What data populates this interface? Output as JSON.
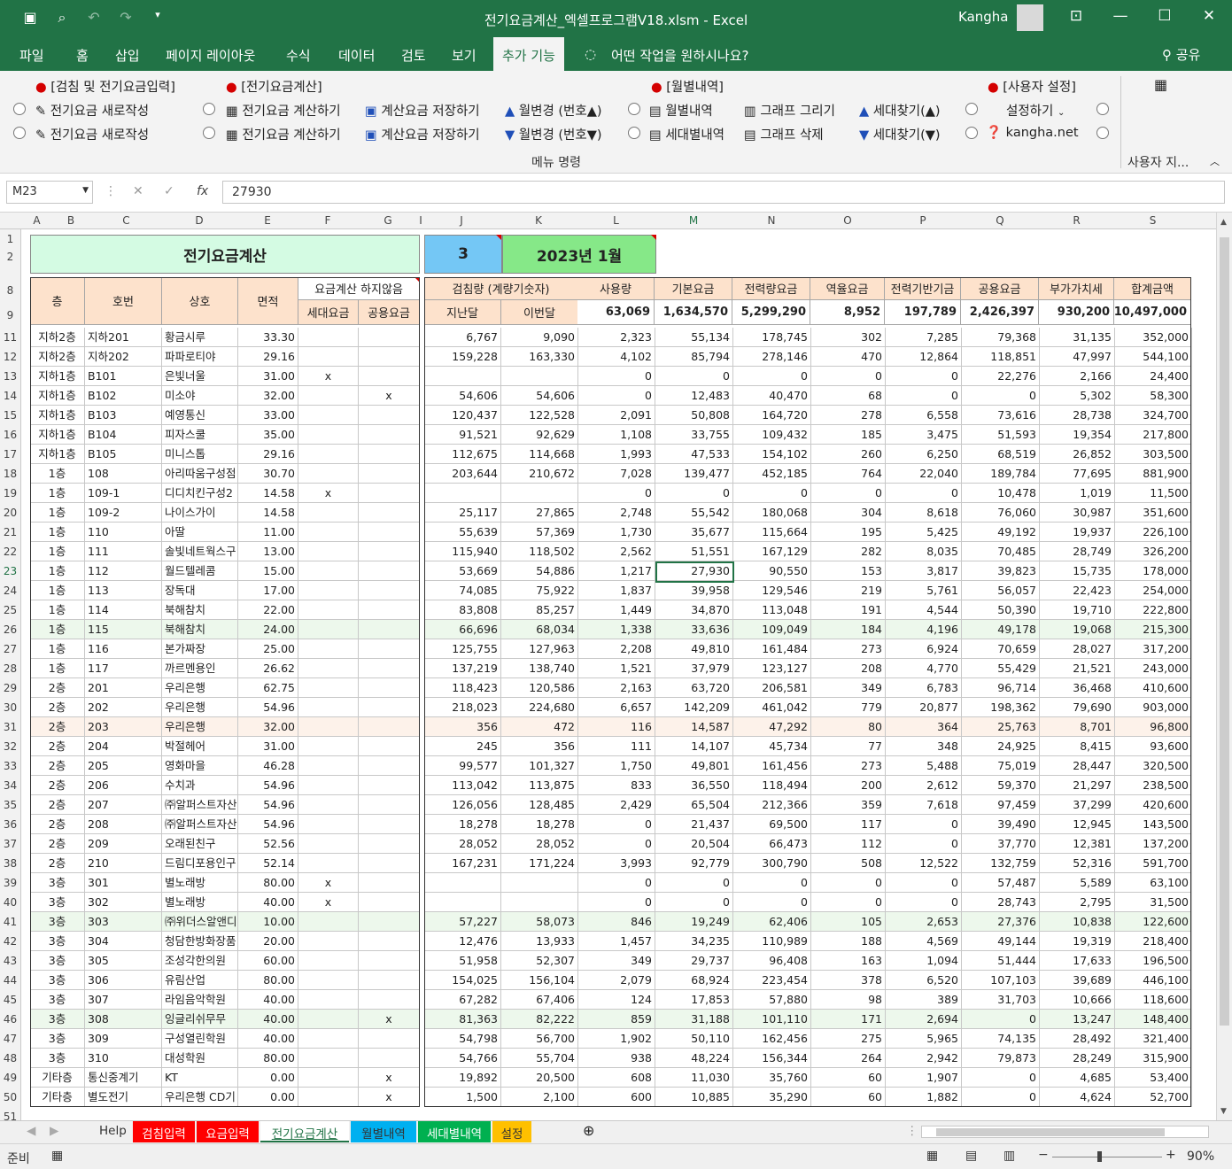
{
  "window": {
    "title": "전기요금계산_엑셀프로그램V18.xlsm  -  Excel",
    "user": "Kangha",
    "qa_icons": [
      "save-icon",
      "print-preview-icon",
      "undo-icon",
      "redo-icon",
      "customize-icon"
    ]
  },
  "menu": {
    "tabs": [
      "파일",
      "홈",
      "삽입",
      "페이지 레이아웃",
      "수식",
      "데이터",
      "검토",
      "보기",
      "추가 기능"
    ],
    "active": "추가 기능",
    "tell_me": "어떤 작업을 원하시나요?",
    "share": "공유"
  },
  "ribbon": {
    "h1": "[검침 및 전기요금입력]",
    "h2": "[전기요금계산]",
    "h3": "[월별내역]",
    "h4": "[사용자 설정]",
    "new1": "전기요금 새로작성",
    "new2": "전기요금 새로작성",
    "calc1": "전기요금 계산하기",
    "calc2": "전기요금 계산하기",
    "save1": "계산요금 저장하기",
    "save2": "계산요금 저장하기",
    "month_up": "월변경 (번호▲)",
    "month_down": "월변경 (번호▼)",
    "monthly": "월별내역",
    "household": "세대별내역",
    "graph_draw": "그래프 그리기",
    "graph_delete": "그래프 삭제",
    "find_up": "세대찾기(▲)",
    "find_down": "세대찾기(▼)",
    "settings": "설정하기",
    "site": "kangha.net",
    "group_label": "메뉴 명령",
    "group_label2": "사용자 지..."
  },
  "formula": {
    "namebox": "M23",
    "value": "27930"
  },
  "columns": [
    "A",
    "B",
    "C",
    "D",
    "E",
    "F",
    "G",
    "I",
    "J",
    "K",
    "L",
    "M",
    "N",
    "O",
    "P",
    "Q",
    "R",
    "S"
  ],
  "rownums": [
    "1",
    "2",
    "8",
    "9",
    "11",
    "12",
    "13",
    "14",
    "15",
    "16",
    "17",
    "18",
    "19",
    "20",
    "21",
    "22",
    "23",
    "24",
    "25",
    "26",
    "27",
    "28",
    "29",
    "30",
    "31",
    "32",
    "33",
    "34",
    "35",
    "36",
    "37",
    "38",
    "39",
    "40",
    "41",
    "42",
    "43",
    "44",
    "45",
    "46",
    "47",
    "48",
    "49",
    "50",
    "51"
  ],
  "sheet": {
    "title": "전기요금계산",
    "month_no": "3",
    "month_label": "2023년 1월",
    "hdr": {
      "floor": "층",
      "unit": "호번",
      "name": "상호",
      "area": "면적",
      "nocalc": "요금계산 하지않음",
      "house": "세대요금",
      "common": "공용요금",
      "meter": "검침량 (계량기숫자)",
      "prev": "지난달",
      "curr": "이번달",
      "usage": "사용량",
      "base": "기본요금",
      "energy": "전력량요금",
      "reverse": "역율요금",
      "fund": "전력기반기금",
      "commonfee": "공용요금",
      "vat": "부가가치세",
      "total": "합계금액"
    },
    "totals": [
      "63,069",
      "1,634,570",
      "5,299,290",
      "8,952",
      "197,789",
      "2,426,397",
      "930,200",
      "10,497,000"
    ],
    "rows": [
      [
        "지하2층",
        "지하201",
        "황금시루",
        "33.30",
        "",
        "",
        "6,767",
        "9,090",
        "2,323",
        "55,134",
        "178,745",
        "302",
        "7,285",
        "79,368",
        "31,135",
        "352,000"
      ],
      [
        "지하2층",
        "지하202",
        "파파로티야",
        "29.16",
        "",
        "",
        "159,228",
        "163,330",
        "4,102",
        "85,794",
        "278,146",
        "470",
        "12,864",
        "118,851",
        "47,997",
        "544,100"
      ],
      [
        "지하1층",
        "B101",
        "은빛너울",
        "31.00",
        "x",
        "",
        "",
        "",
        "0",
        "0",
        "0",
        "0",
        "0",
        "22,276",
        "2,166",
        "24,400"
      ],
      [
        "지하1층",
        "B102",
        "미소야",
        "32.00",
        "",
        "x",
        "54,606",
        "54,606",
        "0",
        "12,483",
        "40,470",
        "68",
        "0",
        "0",
        "5,302",
        "58,300"
      ],
      [
        "지하1층",
        "B103",
        "예영통신",
        "33.00",
        "",
        "",
        "120,437",
        "122,528",
        "2,091",
        "50,808",
        "164,720",
        "278",
        "6,558",
        "73,616",
        "28,738",
        "324,700"
      ],
      [
        "지하1층",
        "B104",
        "피자스쿨",
        "35.00",
        "",
        "",
        "91,521",
        "92,629",
        "1,108",
        "33,755",
        "109,432",
        "185",
        "3,475",
        "51,593",
        "19,354",
        "217,800"
      ],
      [
        "지하1층",
        "B105",
        "미니스톱",
        "29.16",
        "",
        "",
        "112,675",
        "114,668",
        "1,993",
        "47,533",
        "154,102",
        "260",
        "6,250",
        "68,519",
        "26,852",
        "303,500"
      ],
      [
        "1층",
        "108",
        "아리따움구성점",
        "30.70",
        "",
        "",
        "203,644",
        "210,672",
        "7,028",
        "139,477",
        "452,185",
        "764",
        "22,040",
        "189,784",
        "77,695",
        "881,900"
      ],
      [
        "1층",
        "109-1",
        "디디치킨구성2",
        "14.58",
        "x",
        "",
        "",
        "",
        "0",
        "0",
        "0",
        "0",
        "0",
        "10,478",
        "1,019",
        "11,500"
      ],
      [
        "1층",
        "109-2",
        "나이스가이",
        "14.58",
        "",
        "",
        "25,117",
        "27,865",
        "2,748",
        "55,542",
        "180,068",
        "304",
        "8,618",
        "76,060",
        "30,987",
        "351,600"
      ],
      [
        "1층",
        "110",
        "아딸",
        "11.00",
        "",
        "",
        "55,639",
        "57,369",
        "1,730",
        "35,677",
        "115,664",
        "195",
        "5,425",
        "49,192",
        "19,937",
        "226,100"
      ],
      [
        "1층",
        "111",
        "솔빛네트웍스구",
        "13.00",
        "",
        "",
        "115,940",
        "118,502",
        "2,562",
        "51,551",
        "167,129",
        "282",
        "8,035",
        "70,485",
        "28,749",
        "326,200"
      ],
      [
        "1층",
        "112",
        "월드텔레콤",
        "15.00",
        "",
        "",
        "53,669",
        "54,886",
        "1,217",
        "27,930",
        "90,550",
        "153",
        "3,817",
        "39,823",
        "15,735",
        "178,000"
      ],
      [
        "1층",
        "113",
        "장독대",
        "17.00",
        "",
        "",
        "74,085",
        "75,922",
        "1,837",
        "39,958",
        "129,546",
        "219",
        "5,761",
        "56,057",
        "22,423",
        "254,000"
      ],
      [
        "1층",
        "114",
        "북해참치",
        "22.00",
        "",
        "",
        "83,808",
        "85,257",
        "1,449",
        "34,870",
        "113,048",
        "191",
        "4,544",
        "50,390",
        "19,710",
        "222,800"
      ],
      [
        "1층",
        "115",
        "북해참치",
        "24.00",
        "",
        "",
        "66,696",
        "68,034",
        "1,338",
        "33,636",
        "109,049",
        "184",
        "4,196",
        "49,178",
        "19,068",
        "215,300"
      ],
      [
        "1층",
        "116",
        "본가짜장",
        "25.00",
        "",
        "",
        "125,755",
        "127,963",
        "2,208",
        "49,810",
        "161,484",
        "273",
        "6,924",
        "70,659",
        "28,027",
        "317,200"
      ],
      [
        "1층",
        "117",
        "까르멘용인",
        "26.62",
        "",
        "",
        "137,219",
        "138,740",
        "1,521",
        "37,979",
        "123,127",
        "208",
        "4,770",
        "55,429",
        "21,521",
        "243,000"
      ],
      [
        "2층",
        "201",
        "우리은행",
        "62.75",
        "",
        "",
        "118,423",
        "120,586",
        "2,163",
        "63,720",
        "206,581",
        "349",
        "6,783",
        "96,714",
        "36,468",
        "410,600"
      ],
      [
        "2층",
        "202",
        "우리은행",
        "54.96",
        "",
        "",
        "218,023",
        "224,680",
        "6,657",
        "142,209",
        "461,042",
        "779",
        "20,877",
        "198,362",
        "79,690",
        "903,000"
      ],
      [
        "2층",
        "203",
        "우리은행",
        "32.00",
        "",
        "",
        "356",
        "472",
        "116",
        "14,587",
        "47,292",
        "80",
        "364",
        "25,763",
        "8,701",
        "96,800"
      ],
      [
        "2층",
        "204",
        "박절헤어",
        "31.00",
        "",
        "",
        "245",
        "356",
        "111",
        "14,107",
        "45,734",
        "77",
        "348",
        "24,925",
        "8,415",
        "93,600"
      ],
      [
        "2층",
        "205",
        "영화마을",
        "46.28",
        "",
        "",
        "99,577",
        "101,327",
        "1,750",
        "49,801",
        "161,456",
        "273",
        "5,488",
        "75,019",
        "28,447",
        "320,500"
      ],
      [
        "2층",
        "206",
        "수치과",
        "54.96",
        "",
        "",
        "113,042",
        "113,875",
        "833",
        "36,550",
        "118,494",
        "200",
        "2,612",
        "59,370",
        "21,297",
        "238,500"
      ],
      [
        "2층",
        "207",
        "㈜알퍼스트자산",
        "54.96",
        "",
        "",
        "126,056",
        "128,485",
        "2,429",
        "65,504",
        "212,366",
        "359",
        "7,618",
        "97,459",
        "37,299",
        "420,600"
      ],
      [
        "2층",
        "208",
        "㈜알퍼스트자산",
        "54.96",
        "",
        "",
        "18,278",
        "18,278",
        "0",
        "21,437",
        "69,500",
        "117",
        "0",
        "39,490",
        "12,945",
        "143,500"
      ],
      [
        "2층",
        "209",
        "오래된친구",
        "52.56",
        "",
        "",
        "28,052",
        "28,052",
        "0",
        "20,504",
        "66,473",
        "112",
        "0",
        "37,770",
        "12,381",
        "137,200"
      ],
      [
        "2층",
        "210",
        "드림디포용인구",
        "52.14",
        "",
        "",
        "167,231",
        "171,224",
        "3,993",
        "92,779",
        "300,790",
        "508",
        "12,522",
        "132,759",
        "52,316",
        "591,700"
      ],
      [
        "3층",
        "301",
        "별노래방",
        "80.00",
        "x",
        "",
        "",
        "",
        "0",
        "0",
        "0",
        "0",
        "0",
        "57,487",
        "5,589",
        "63,100"
      ],
      [
        "3층",
        "302",
        "별노래방",
        "40.00",
        "x",
        "",
        "",
        "",
        "0",
        "0",
        "0",
        "0",
        "0",
        "28,743",
        "2,795",
        "31,500"
      ],
      [
        "3층",
        "303",
        "㈜위더스알앤디",
        "10.00",
        "",
        "",
        "57,227",
        "58,073",
        "846",
        "19,249",
        "62,406",
        "105",
        "2,653",
        "27,376",
        "10,838",
        "122,600"
      ],
      [
        "3층",
        "304",
        "청담한방화장품",
        "20.00",
        "",
        "",
        "12,476",
        "13,933",
        "1,457",
        "34,235",
        "110,989",
        "188",
        "4,569",
        "49,144",
        "19,319",
        "218,400"
      ],
      [
        "3층",
        "305",
        "조성각한의원",
        "60.00",
        "",
        "",
        "51,958",
        "52,307",
        "349",
        "29,737",
        "96,408",
        "163",
        "1,094",
        "51,444",
        "17,633",
        "196,500"
      ],
      [
        "3층",
        "306",
        "유림산업",
        "80.00",
        "",
        "",
        "154,025",
        "156,104",
        "2,079",
        "68,924",
        "223,454",
        "378",
        "6,520",
        "107,103",
        "39,689",
        "446,100"
      ],
      [
        "3층",
        "307",
        "라임음악학원",
        "40.00",
        "",
        "",
        "67,282",
        "67,406",
        "124",
        "17,853",
        "57,880",
        "98",
        "389",
        "31,703",
        "10,666",
        "118,600"
      ],
      [
        "3층",
        "308",
        "잉글리쉬무무",
        "40.00",
        "",
        "x",
        "81,363",
        "82,222",
        "859",
        "31,188",
        "101,110",
        "171",
        "2,694",
        "0",
        "13,247",
        "148,400"
      ],
      [
        "3층",
        "309",
        "구성열린학원",
        "40.00",
        "",
        "",
        "54,798",
        "56,700",
        "1,902",
        "50,110",
        "162,456",
        "275",
        "5,965",
        "74,135",
        "28,492",
        "321,400"
      ],
      [
        "3층",
        "310",
        "대성학원",
        "80.00",
        "",
        "",
        "54,766",
        "55,704",
        "938",
        "48,224",
        "156,344",
        "264",
        "2,942",
        "79,873",
        "28,249",
        "315,900"
      ],
      [
        "기타층",
        "통신중계기",
        "KT",
        "0.00",
        "",
        "x",
        "19,892",
        "20,500",
        "608",
        "11,030",
        "35,760",
        "60",
        "1,907",
        "0",
        "4,685",
        "53,400"
      ],
      [
        "기타층",
        "별도전기",
        "우리은행 CD기",
        "0.00",
        "",
        "x",
        "1,500",
        "2,100",
        "600",
        "10,885",
        "35,290",
        "60",
        "1,882",
        "0",
        "4,624",
        "52,700"
      ]
    ]
  },
  "sheets": [
    "Help",
    "검침입력",
    "요금입력",
    "전기요금계산",
    "월별내역",
    "세대별내역",
    "설정"
  ],
  "sheet_colors": [
    "#f0f0f0",
    "#ff0000",
    "#ff0000",
    "#ffffff",
    "#00b0f0",
    "#00b050",
    "#ffc000"
  ],
  "active_sheet": "전기요금계산",
  "status": {
    "ready": "준비",
    "zoom": "90%"
  },
  "colors": {
    "excel_green": "#217346",
    "title_fill": "#d4fbe3",
    "month_no_fill": "#74c7f5",
    "month_fill": "#86e888",
    "header_fill": "#fde2cc",
    "band_fill": "#edf8ec"
  }
}
